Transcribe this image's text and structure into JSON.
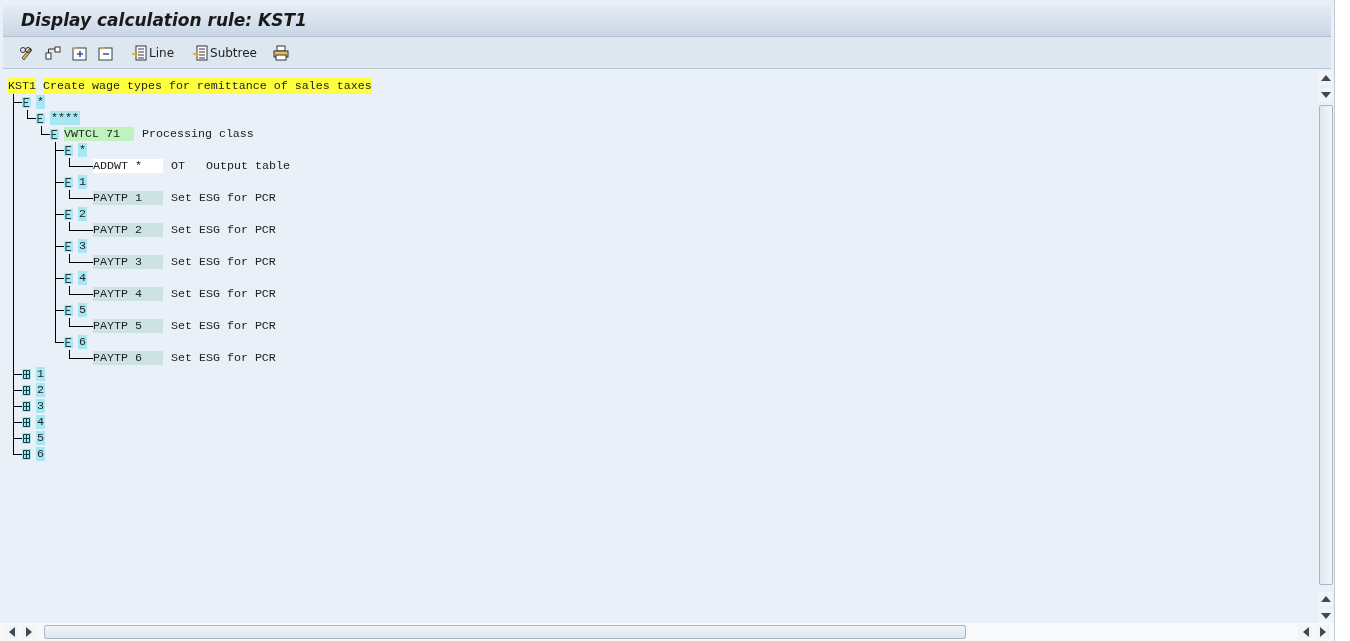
{
  "window": {
    "title": "Display calculation rule: KST1"
  },
  "toolbar": {
    "buttons": [
      {
        "label": "Line"
      },
      {
        "label": "Subtree"
      }
    ]
  },
  "rule": {
    "name": "KST1",
    "description": "Create wage types for remittance of sales taxes"
  },
  "tree": [
    {
      "kind": "group",
      "label": "*",
      "expanded": true,
      "children": [
        {
          "kind": "group",
          "label": "****",
          "expanded": true,
          "children": [
            {
              "kind": "operation",
              "operation": "VWTCL 71",
              "color": "#bff2bf",
              "description": "Processing class",
              "expanded": true,
              "children": [
                {
                  "kind": "group",
                  "label": "*",
                  "expanded": true,
                  "children": [
                    {
                      "kind": "operation",
                      "operation": "ADDWT *",
                      "color": "#ffffff",
                      "parameter": "OT",
                      "description": "Output table"
                    }
                  ]
                },
                {
                  "kind": "group",
                  "label": "1",
                  "expanded": true,
                  "children": [
                    {
                      "kind": "operation",
                      "operation": "PAYTP 1",
                      "color": "#cde3e3",
                      "description": "Set ESG for PCR"
                    }
                  ]
                },
                {
                  "kind": "group",
                  "label": "2",
                  "expanded": true,
                  "children": [
                    {
                      "kind": "operation",
                      "operation": "PAYTP 2",
                      "color": "#cde3e3",
                      "description": "Set ESG for PCR"
                    }
                  ]
                },
                {
                  "kind": "group",
                  "label": "3",
                  "expanded": true,
                  "children": [
                    {
                      "kind": "operation",
                      "operation": "PAYTP 3",
                      "color": "#cde3e3",
                      "description": "Set ESG for PCR"
                    }
                  ]
                },
                {
                  "kind": "group",
                  "label": "4",
                  "expanded": true,
                  "children": [
                    {
                      "kind": "operation",
                      "operation": "PAYTP 4",
                      "color": "#cde3e3",
                      "description": "Set ESG for PCR"
                    }
                  ]
                },
                {
                  "kind": "group",
                  "label": "5",
                  "expanded": true,
                  "children": [
                    {
                      "kind": "operation",
                      "operation": "PAYTP 5",
                      "color": "#cde3e3",
                      "description": "Set ESG for PCR"
                    }
                  ]
                },
                {
                  "kind": "group",
                  "label": "6",
                  "expanded": true,
                  "children": [
                    {
                      "kind": "operation",
                      "operation": "PAYTP 6",
                      "color": "#cde3e3",
                      "description": "Set ESG for PCR"
                    }
                  ]
                }
              ]
            }
          ]
        }
      ]
    },
    {
      "kind": "group",
      "label": "1",
      "expanded": false
    },
    {
      "kind": "group",
      "label": "2",
      "expanded": false
    },
    {
      "kind": "group",
      "label": "3",
      "expanded": false
    },
    {
      "kind": "group",
      "label": "4",
      "expanded": false
    },
    {
      "kind": "group",
      "label": "5",
      "expanded": false
    },
    {
      "kind": "group",
      "label": "6",
      "expanded": false
    }
  ]
}
